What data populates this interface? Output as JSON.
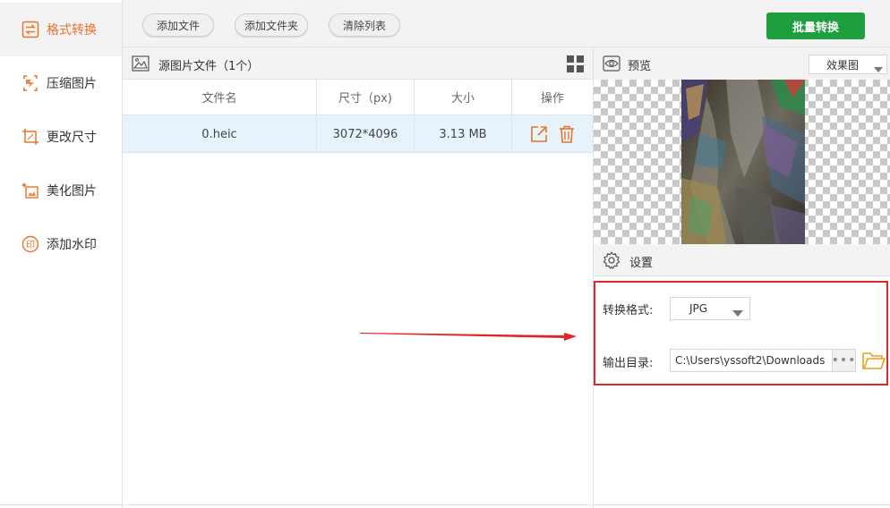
{
  "sidebar": {
    "items": [
      {
        "label": "格式转换",
        "icon": "convert-icon",
        "active": true
      },
      {
        "label": "压缩图片",
        "icon": "compress-icon",
        "active": false
      },
      {
        "label": "更改尺寸",
        "icon": "resize-icon",
        "active": false
      },
      {
        "label": "美化图片",
        "icon": "beautify-icon",
        "active": false
      },
      {
        "label": "添加水印",
        "icon": "watermark-icon",
        "active": false
      }
    ]
  },
  "toolbar": {
    "add_file": "添加文件",
    "add_folder": "添加文件夹",
    "clear_list": "清除列表",
    "batch_convert": "批量转换"
  },
  "file_panel": {
    "title": "源图片文件（1个）",
    "columns": [
      "文件名",
      "尺寸（px)",
      "大小",
      "操作"
    ],
    "rows": [
      {
        "name": "0.heic",
        "dimensions": "3072*4096",
        "size": "3.13 MB"
      }
    ]
  },
  "preview": {
    "title": "预览",
    "mode_select": "效果图"
  },
  "settings": {
    "title": "设置",
    "format_label": "转换格式:",
    "format_value": "JPG",
    "output_label": "输出目录:",
    "output_path": "C:\\Users\\yssoft2\\Downloads",
    "browse_dots": "•••"
  },
  "colors": {
    "accent": "#e8742a",
    "primary_green": "#1e9e3e",
    "highlight_red": "#e0262a",
    "selected_row": "#e6f3fb"
  }
}
